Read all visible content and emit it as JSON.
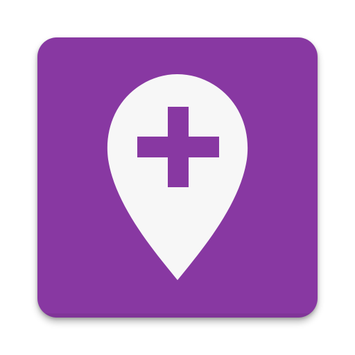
{
  "icon": {
    "name": "map-pin-plus-icon",
    "tile_color": "#8838A2",
    "pin_color": "#F7F7F7",
    "plus_color": "#8838A2"
  }
}
